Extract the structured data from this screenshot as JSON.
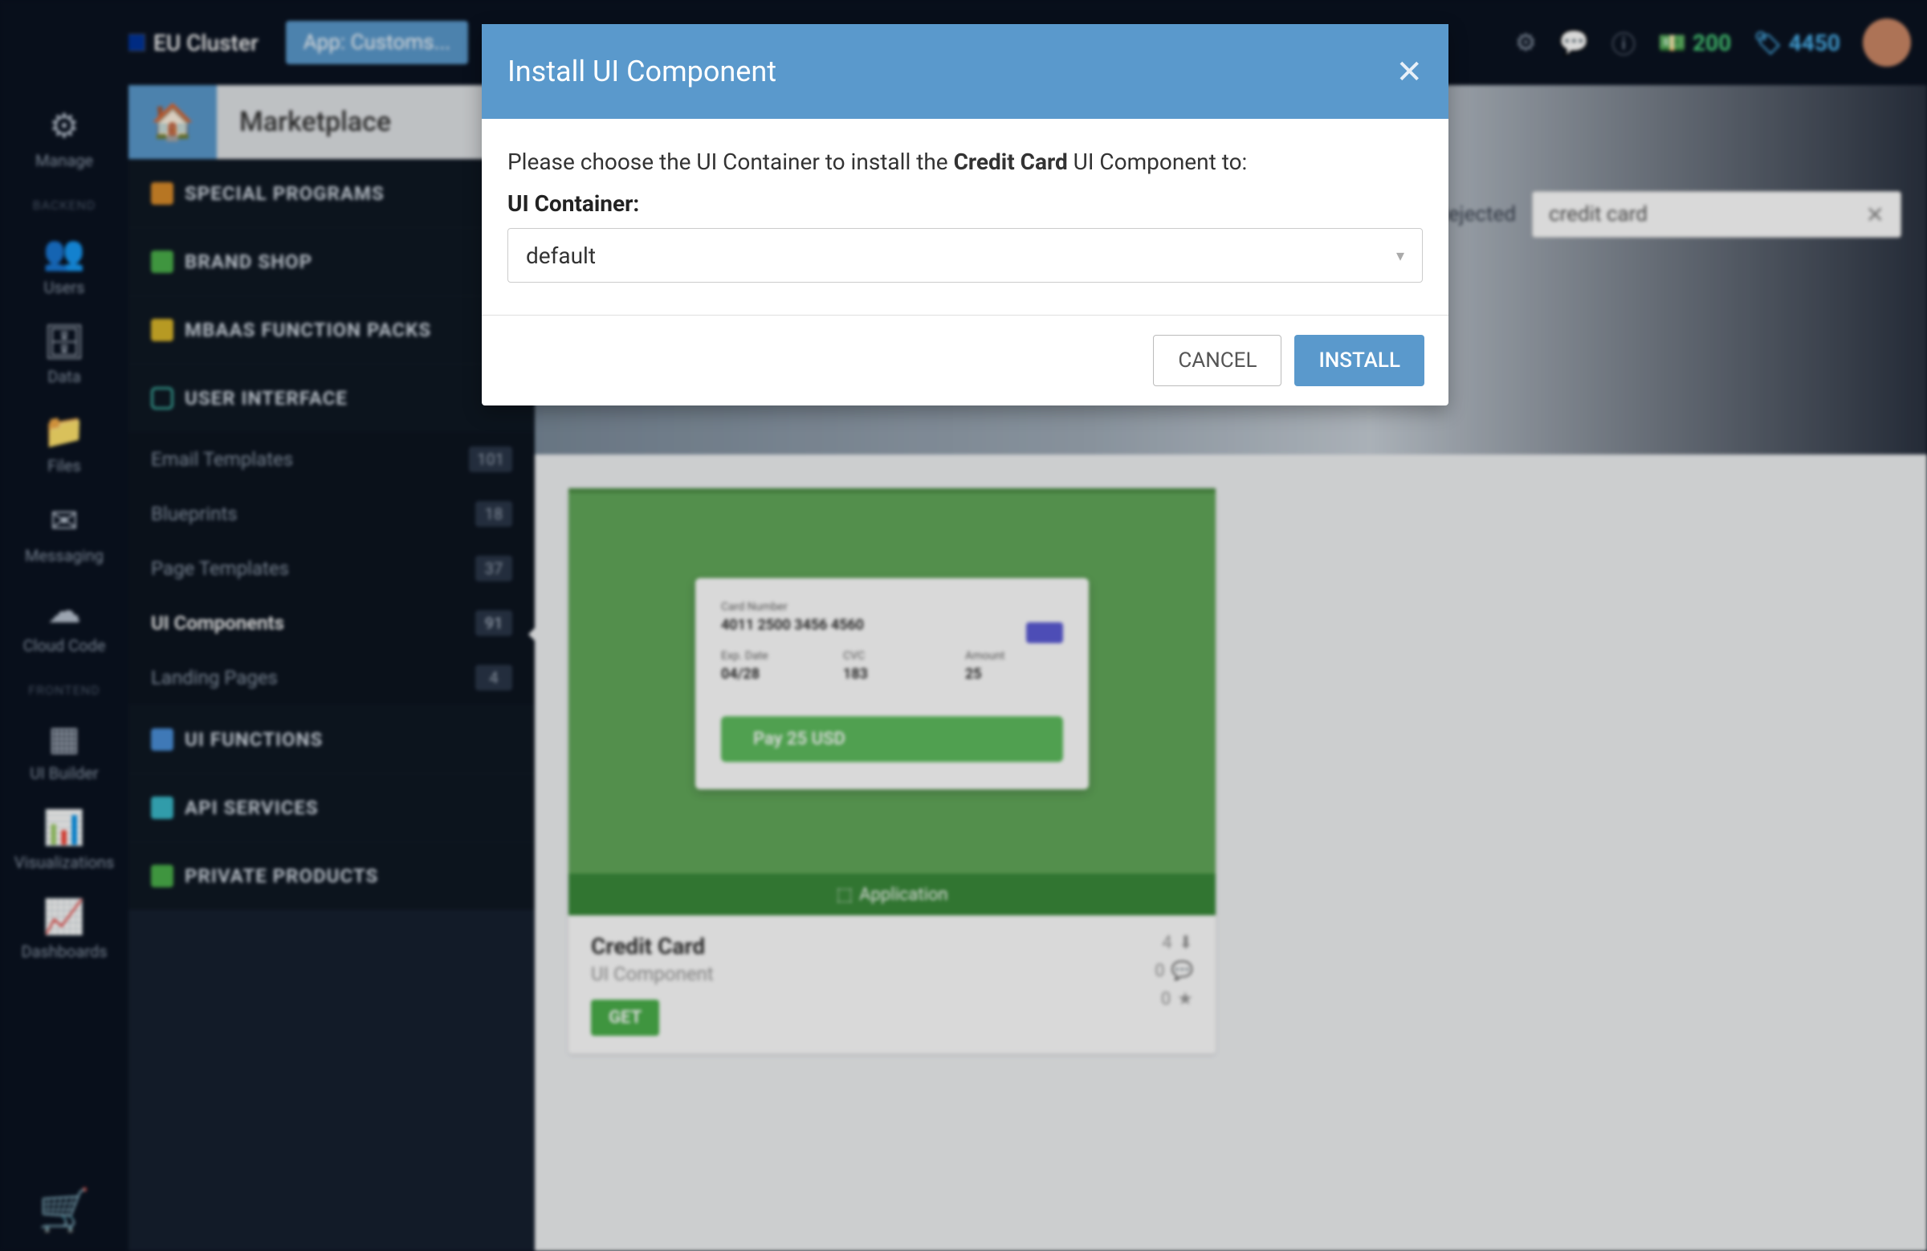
{
  "topbar": {
    "cluster": "EU Cluster",
    "app_pill": "App: Customs...",
    "credits_green": "200",
    "credits_blue": "4450"
  },
  "rail": {
    "items": [
      {
        "icon": "⚙",
        "label": "Manage"
      },
      {
        "heading": "BACKEND"
      },
      {
        "icon": "👥",
        "label": "Users"
      },
      {
        "icon": "🗄",
        "label": "Data"
      },
      {
        "icon": "📁",
        "label": "Files"
      },
      {
        "icon": "✉",
        "label": "Messaging"
      },
      {
        "icon": "☁",
        "label": "Cloud Code"
      },
      {
        "heading": "FRONTEND"
      },
      {
        "icon": "▦",
        "label": "UI Builder"
      },
      {
        "icon": "📊",
        "label": "Visualizations"
      },
      {
        "icon": "📈",
        "label": "Dashboards"
      }
    ]
  },
  "cat": {
    "home": "🏠",
    "market": "Marketplace",
    "items": [
      {
        "label": "SPECIAL PROGRAMS",
        "color": "orange"
      },
      {
        "label": "BRAND SHOP",
        "color": "green"
      },
      {
        "label": "MBAAS FUNCTION PACKS",
        "color": "yellow"
      },
      {
        "label": "USER INTERFACE",
        "color": "teal",
        "expanded": true
      },
      {
        "label": "UI FUNCTIONS",
        "color": "blue"
      },
      {
        "label": "API SERVICES",
        "color": "cyan"
      },
      {
        "label": "PRIVATE PRODUCTS",
        "color": "grn2"
      }
    ],
    "subs": [
      {
        "label": "Email Templates",
        "badge": "101"
      },
      {
        "label": "Blueprints",
        "badge": "18"
      },
      {
        "label": "Page Templates",
        "badge": "37"
      },
      {
        "label": "UI Components",
        "badge": "91",
        "active": true
      },
      {
        "label": "Landing Pages",
        "badge": "4"
      }
    ]
  },
  "filter": {
    "rejected": "Rejected",
    "search_value": "credit card"
  },
  "card": {
    "cc_number_label": "Card Number",
    "cc_number": "4011 2500 3456 4560",
    "exp_label": "Exp. Date",
    "exp": "04/28",
    "cvc_label": "CVC",
    "cvc": "183",
    "amount_label": "Amount",
    "amount": "25",
    "pay": "Pay 25 USD",
    "app_bar": "Application",
    "title": "Credit Card",
    "subtitle": "UI Component",
    "get": "GET",
    "stat_downloads": "4",
    "stat_comments": "0",
    "stat_stars": "0"
  },
  "modal": {
    "title": "Install UI Component",
    "text_prefix": "Please choose the UI Container to install the ",
    "text_strong": "Credit Card",
    "text_suffix": " UI Component to:",
    "label": "UI Container:",
    "select_value": "default",
    "cancel": "CANCEL",
    "install": "INSTALL"
  }
}
